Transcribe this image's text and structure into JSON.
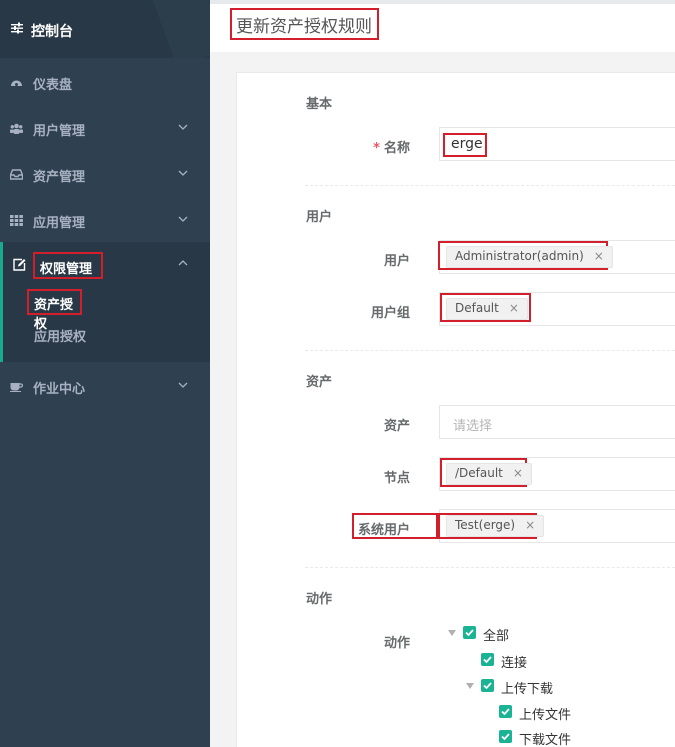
{
  "sidebar": {
    "brand": "控制台",
    "items": [
      {
        "label": "仪表盘"
      },
      {
        "label": "用户管理"
      },
      {
        "label": "资产管理"
      },
      {
        "label": "应用管理"
      },
      {
        "label": "权限管理",
        "sub": [
          "资产授权",
          "应用授权"
        ]
      },
      {
        "label": "作业中心"
      }
    ]
  },
  "header": {
    "title": "更新资产授权规则"
  },
  "form": {
    "sections": {
      "basic": "基本",
      "user": "用户",
      "asset": "资产",
      "action": "动作"
    },
    "name_label": "名称",
    "name_required": "*",
    "name_value": "erge",
    "users_label": "用户",
    "users_tags": [
      "Administrator(admin)"
    ],
    "user_groups_label": "用户组",
    "user_groups_tags": [
      "Default"
    ],
    "assets_label": "资产",
    "assets_placeholder": "请选择",
    "nodes_label": "节点",
    "nodes_tags": [
      "/Default"
    ],
    "system_users_label": "系统用户",
    "system_users_tags": [
      "Test(erge)"
    ],
    "tag_remove": "×",
    "actions_label": "动作",
    "actions_tree": [
      "全部",
      "连接",
      "上传下载",
      "上传文件",
      "下载文件"
    ]
  },
  "colors": {
    "sidebar_bg": "#2f4050",
    "accent": "#1ab394",
    "highlight": "#d21f2b"
  }
}
